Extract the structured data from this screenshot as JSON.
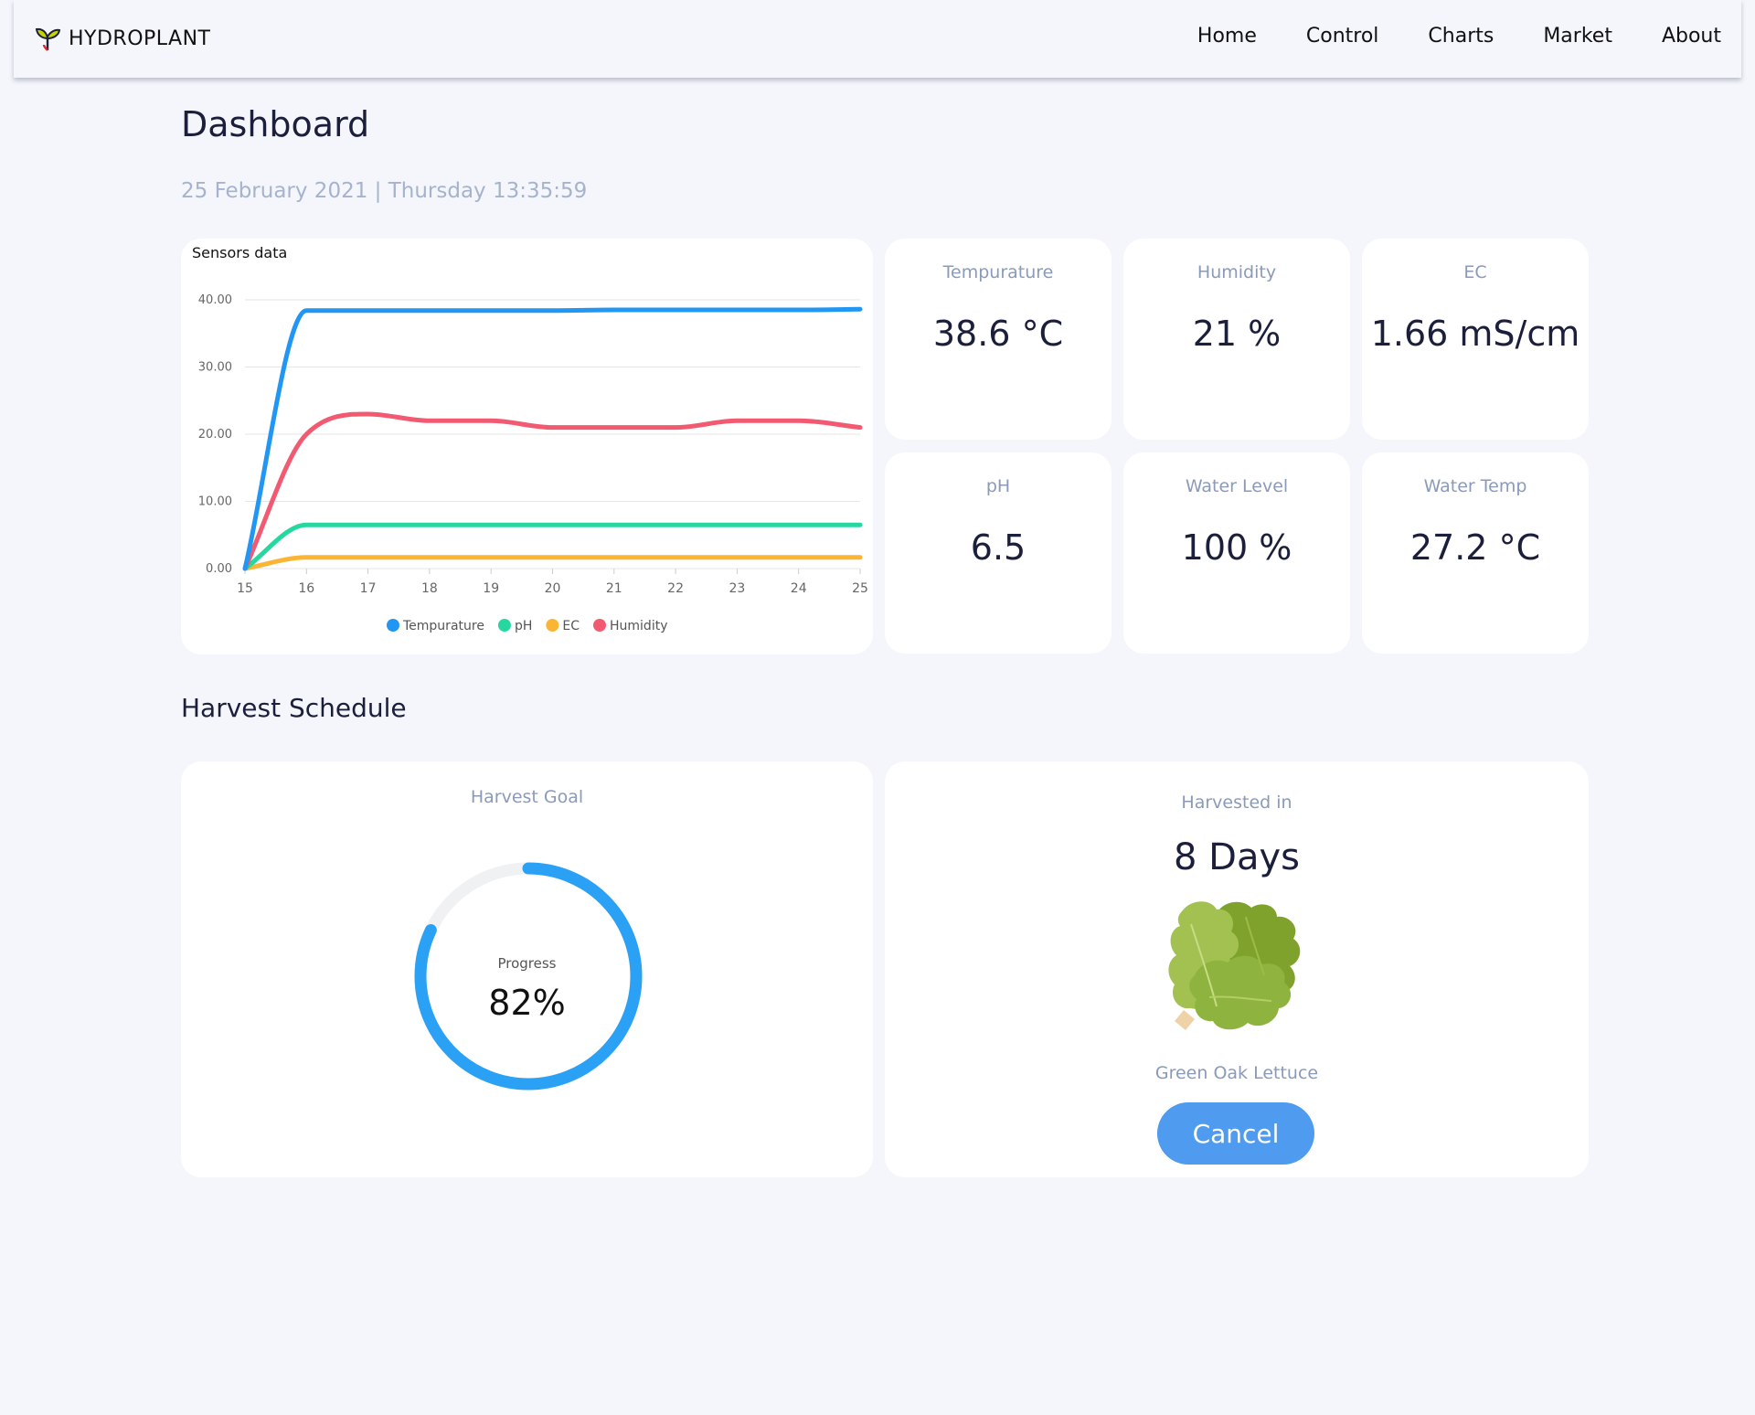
{
  "nav": {
    "brand": "HYDROPLANT",
    "links": [
      "Home",
      "Control",
      "Charts",
      "Market",
      "About"
    ]
  },
  "header": {
    "title": "Dashboard",
    "datetime": "25 February 2021 | Thursday 13:35:59"
  },
  "sensors_card": {
    "title": "Sensors data"
  },
  "stats": [
    {
      "label": "Tempurature",
      "value": "38.6 °C"
    },
    {
      "label": "Humidity",
      "value": "21 %"
    },
    {
      "label": "EC",
      "value": "1.66 mS/cm"
    },
    {
      "label": "pH",
      "value": "6.5"
    },
    {
      "label": "Water Level",
      "value": "100 %"
    },
    {
      "label": "Water Temp",
      "value": "27.2 °C"
    }
  ],
  "harvest": {
    "section_title": "Harvest Schedule",
    "goal_label": "Harvest Goal",
    "progress_caption": "Progress",
    "progress_text": "82%",
    "progress": 0.82,
    "harvested_label": "Harvested in",
    "days": "8 Days",
    "plant_name": "Green Oak Lettuce",
    "cancel_label": "Cancel"
  },
  "colors": {
    "accent": "#2aa1f5",
    "button": "#4e9bef",
    "muted": "#8a9ab8",
    "track": "#f0f1f3"
  },
  "chart_data": {
    "type": "line",
    "title": "Sensors data",
    "x": [
      15,
      16,
      17,
      18,
      19,
      20,
      21,
      22,
      23,
      24,
      25
    ],
    "ylim": [
      0,
      40
    ],
    "yticks": [
      "0.00",
      "10.00",
      "20.00",
      "30.00",
      "40.00"
    ],
    "grid": true,
    "legend": "bottom",
    "series": [
      {
        "name": "Tempurature",
        "color": "#2196f3",
        "values": [
          0,
          38.4,
          38.4,
          38.4,
          38.4,
          38.4,
          38.5,
          38.5,
          38.5,
          38.5,
          38.6
        ]
      },
      {
        "name": "pH",
        "color": "#26d8a0",
        "values": [
          0,
          6.5,
          6.5,
          6.5,
          6.5,
          6.5,
          6.5,
          6.5,
          6.5,
          6.5,
          6.5
        ]
      },
      {
        "name": "EC",
        "color": "#fbb535",
        "values": [
          0,
          1.66,
          1.66,
          1.66,
          1.66,
          1.66,
          1.66,
          1.66,
          1.66,
          1.66,
          1.66
        ]
      },
      {
        "name": "Humidity",
        "color": "#f25a72",
        "values": [
          0,
          20,
          23,
          22,
          22,
          21,
          21,
          21,
          22,
          22,
          21
        ]
      }
    ]
  }
}
